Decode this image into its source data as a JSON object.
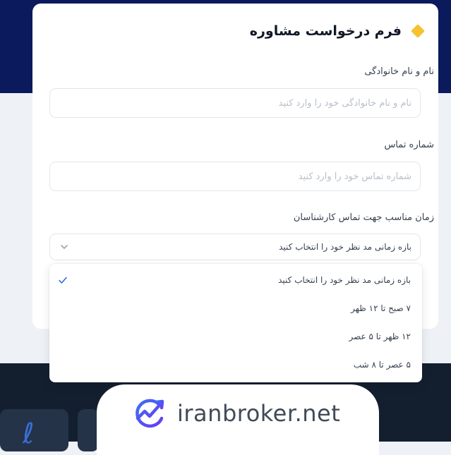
{
  "form": {
    "title": "فرم درخواست مشاوره",
    "fields": {
      "full_name": {
        "label": "نام و نام خانوادگی",
        "placeholder": "نام و نام خانوادگی خود را وارد کنید"
      },
      "phone": {
        "label": "شماره تماس",
        "placeholder": "شماره تماس خود را وارد کنید"
      },
      "time": {
        "label": "زمان مناسب جهت تماس کارشناسان",
        "selected": "بازه زمانی مد نظر خود را انتخاب کنید",
        "options": [
          {
            "label": "بازه زمانی مد نظر خود را انتخاب کنید",
            "selected": true
          },
          {
            "label": "۷ صبح تا ۱۲ ظهر",
            "selected": false
          },
          {
            "label": "۱۲ ظهر تا ۵ عصر",
            "selected": false
          },
          {
            "label": "۵ عصر تا ۸ شب",
            "selected": false
          }
        ]
      }
    }
  },
  "watermark": {
    "text": "iranbroker.net"
  },
  "colors": {
    "header_navy": "#0a1a5c",
    "footer_dark": "#131f2f",
    "accent_yellow": "#f6c22d",
    "check_blue": "#2563eb"
  }
}
